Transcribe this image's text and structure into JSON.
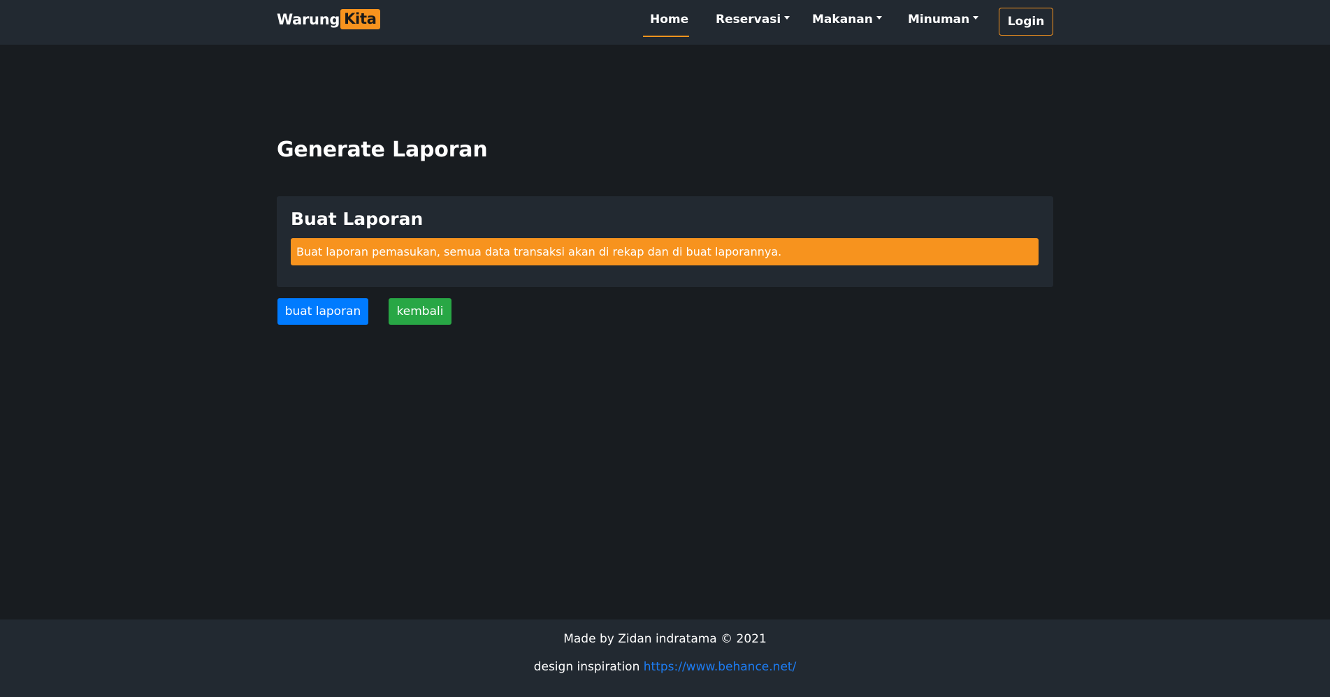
{
  "navbar": {
    "brand_part1": "Warung",
    "brand_part2": "Kita",
    "items": [
      {
        "label": "Home",
        "dropdown": false,
        "active": true
      },
      {
        "label": "Reservasi",
        "dropdown": true,
        "active": false
      },
      {
        "label": "Makanan",
        "dropdown": true,
        "active": false
      },
      {
        "label": "Minuman",
        "dropdown": true,
        "active": false
      }
    ],
    "login_label": "Login"
  },
  "main": {
    "title": "Generate Laporan",
    "card": {
      "title": "Buat Laporan",
      "alert_text": "Buat laporan pemasukan, semua data transaksi akan di rekap dan di buat laporannya."
    },
    "buttons": {
      "create_label": "buat laporan",
      "back_label": "kembali"
    }
  },
  "footer": {
    "credit": "Made by Zidan indratama © 2021",
    "inspiration_label": "design inspiration",
    "inspiration_link": "https://www.behance.net/"
  },
  "colors": {
    "accent": "#f7931e",
    "primary": "#007bff",
    "success": "#28a745",
    "background": "#181c20",
    "panel": "#222931"
  }
}
